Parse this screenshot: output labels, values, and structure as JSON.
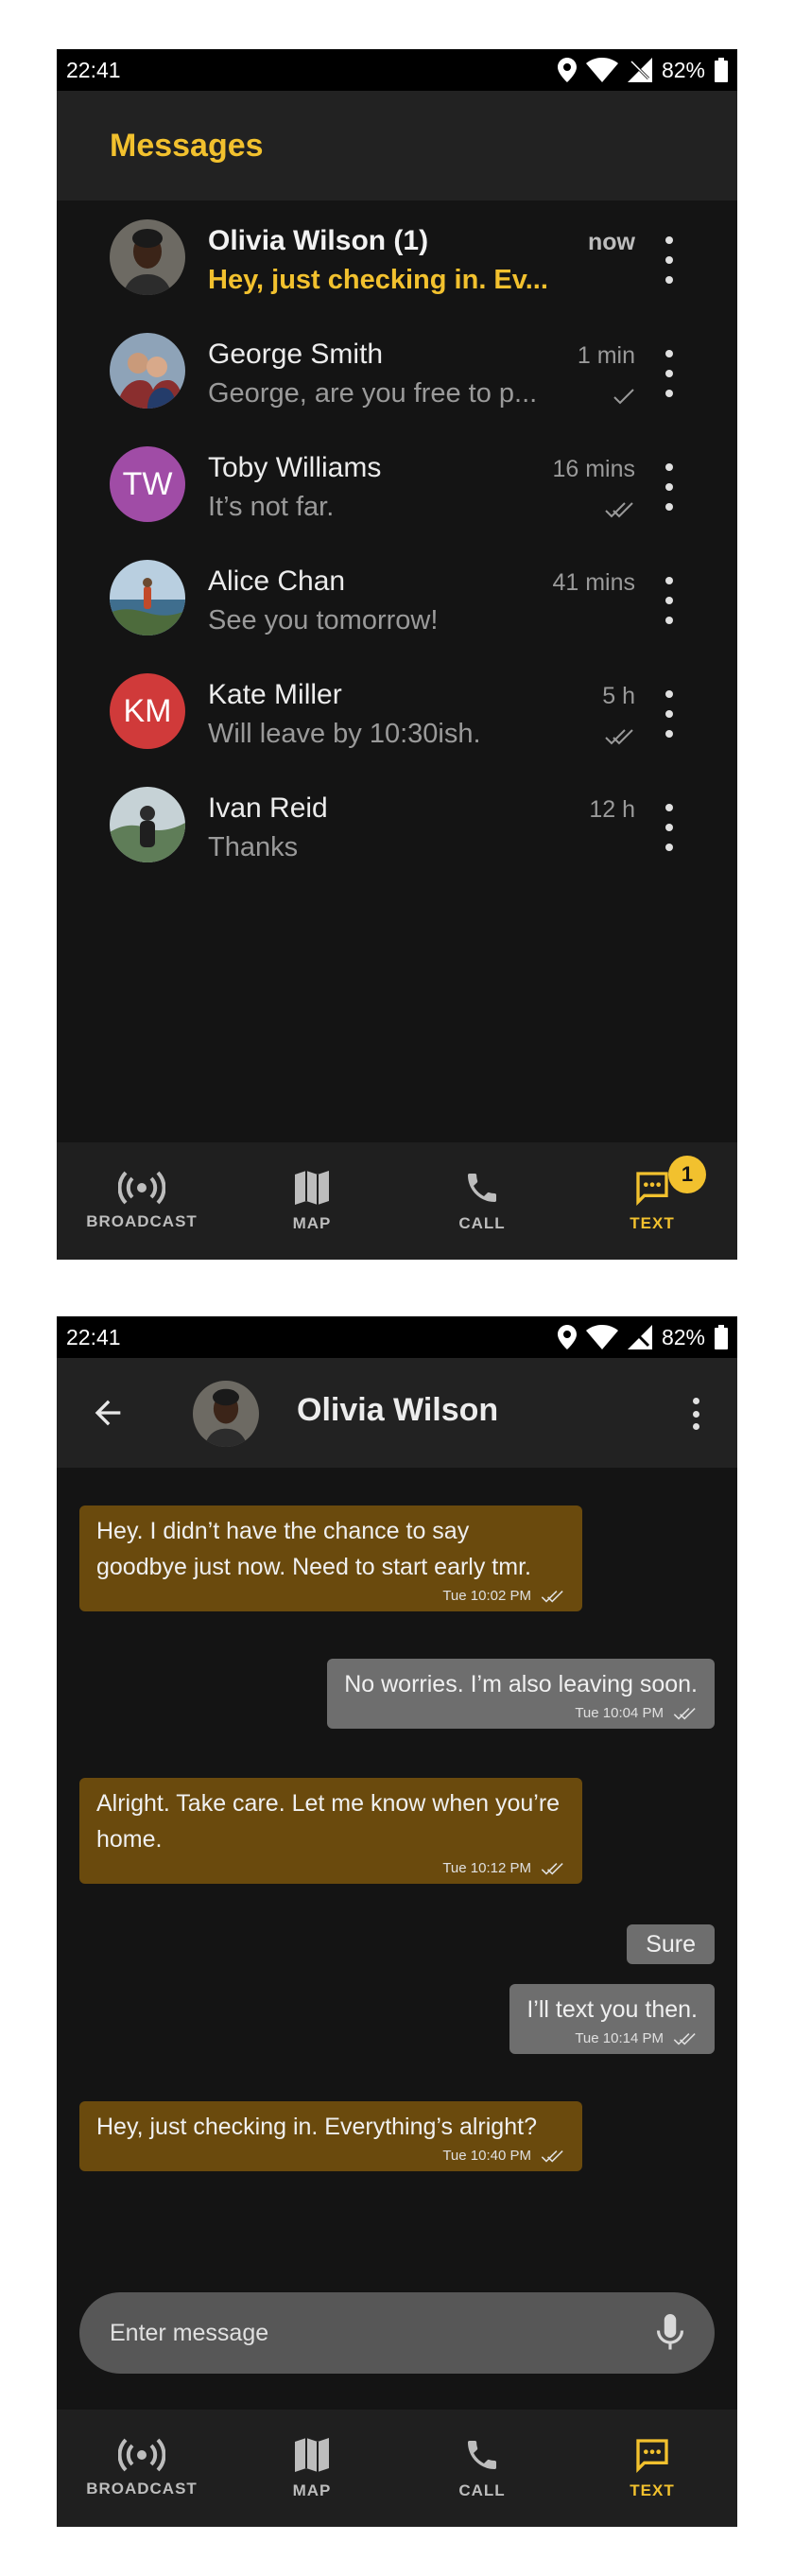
{
  "status_bar": {
    "time": "22:41",
    "battery": "82%"
  },
  "inbox": {
    "title": "Messages",
    "conversations": [
      {
        "name": "Olivia Wilson (1)",
        "preview": "Hey, just checking in. Ev...",
        "time": "now",
        "unread": true,
        "avatar": "photo-woman-icon",
        "receipt": "none"
      },
      {
        "name": "George Smith",
        "preview": "George, are you free to p...",
        "time": "1 min",
        "unread": false,
        "avatar": "photo-couple-icon",
        "receipt": "sent"
      },
      {
        "name": "Toby Williams",
        "preview": "It’s not far.",
        "time": "16 mins",
        "unread": false,
        "avatar_initials": "TW",
        "avatar_color": "#a04ca6",
        "receipt": "read"
      },
      {
        "name": "Alice Chan",
        "preview": "See you tomorrow!",
        "time": "41 mins",
        "unread": false,
        "avatar": "photo-landscape-icon",
        "receipt": "none"
      },
      {
        "name": "Kate Miller",
        "preview": "Will leave by 10:30ish.",
        "time": "5 h",
        "unread": false,
        "avatar_initials": "KM",
        "avatar_color": "#d03a3a",
        "receipt": "read"
      },
      {
        "name": "Ivan Reid",
        "preview": "Thanks",
        "time": "12 h",
        "unread": false,
        "avatar": "photo-man-icon",
        "receipt": "none"
      }
    ]
  },
  "nav": {
    "items": [
      {
        "label": "BROADCAST",
        "icon": "broadcast-icon"
      },
      {
        "label": "MAP",
        "icon": "map-icon"
      },
      {
        "label": "CALL",
        "icon": "phone-icon"
      },
      {
        "label": "TEXT",
        "icon": "message-icon",
        "active": true
      }
    ],
    "text_badge": "1"
  },
  "chat": {
    "title": "Olivia Wilson",
    "messages": [
      {
        "dir": "in",
        "text": "Hey. I didn’t have the chance to say goodbye just now. Need to start early tmr.",
        "time": "Tue 10:02 PM"
      },
      {
        "dir": "out",
        "text": "No worries. I’m also leaving soon.",
        "time": "Tue 10:04 PM"
      },
      {
        "dir": "in",
        "text": "Alright. Take care. Let me know when you’re home.",
        "time": "Tue 10:12 PM"
      },
      {
        "dir": "out",
        "text": "Sure",
        "time": ""
      },
      {
        "dir": "out",
        "text": "I’ll text you then.",
        "time": "Tue 10:14 PM"
      },
      {
        "dir": "in",
        "text": "Hey, just checking in. Everything’s alright?",
        "time": "Tue 10:40 PM"
      }
    ],
    "input_placeholder": "Enter message"
  },
  "colors": {
    "accent": "#f2c12e",
    "incoming": "#6a4a0d",
    "outgoing": "#6e6e6e",
    "background": "#141414"
  }
}
